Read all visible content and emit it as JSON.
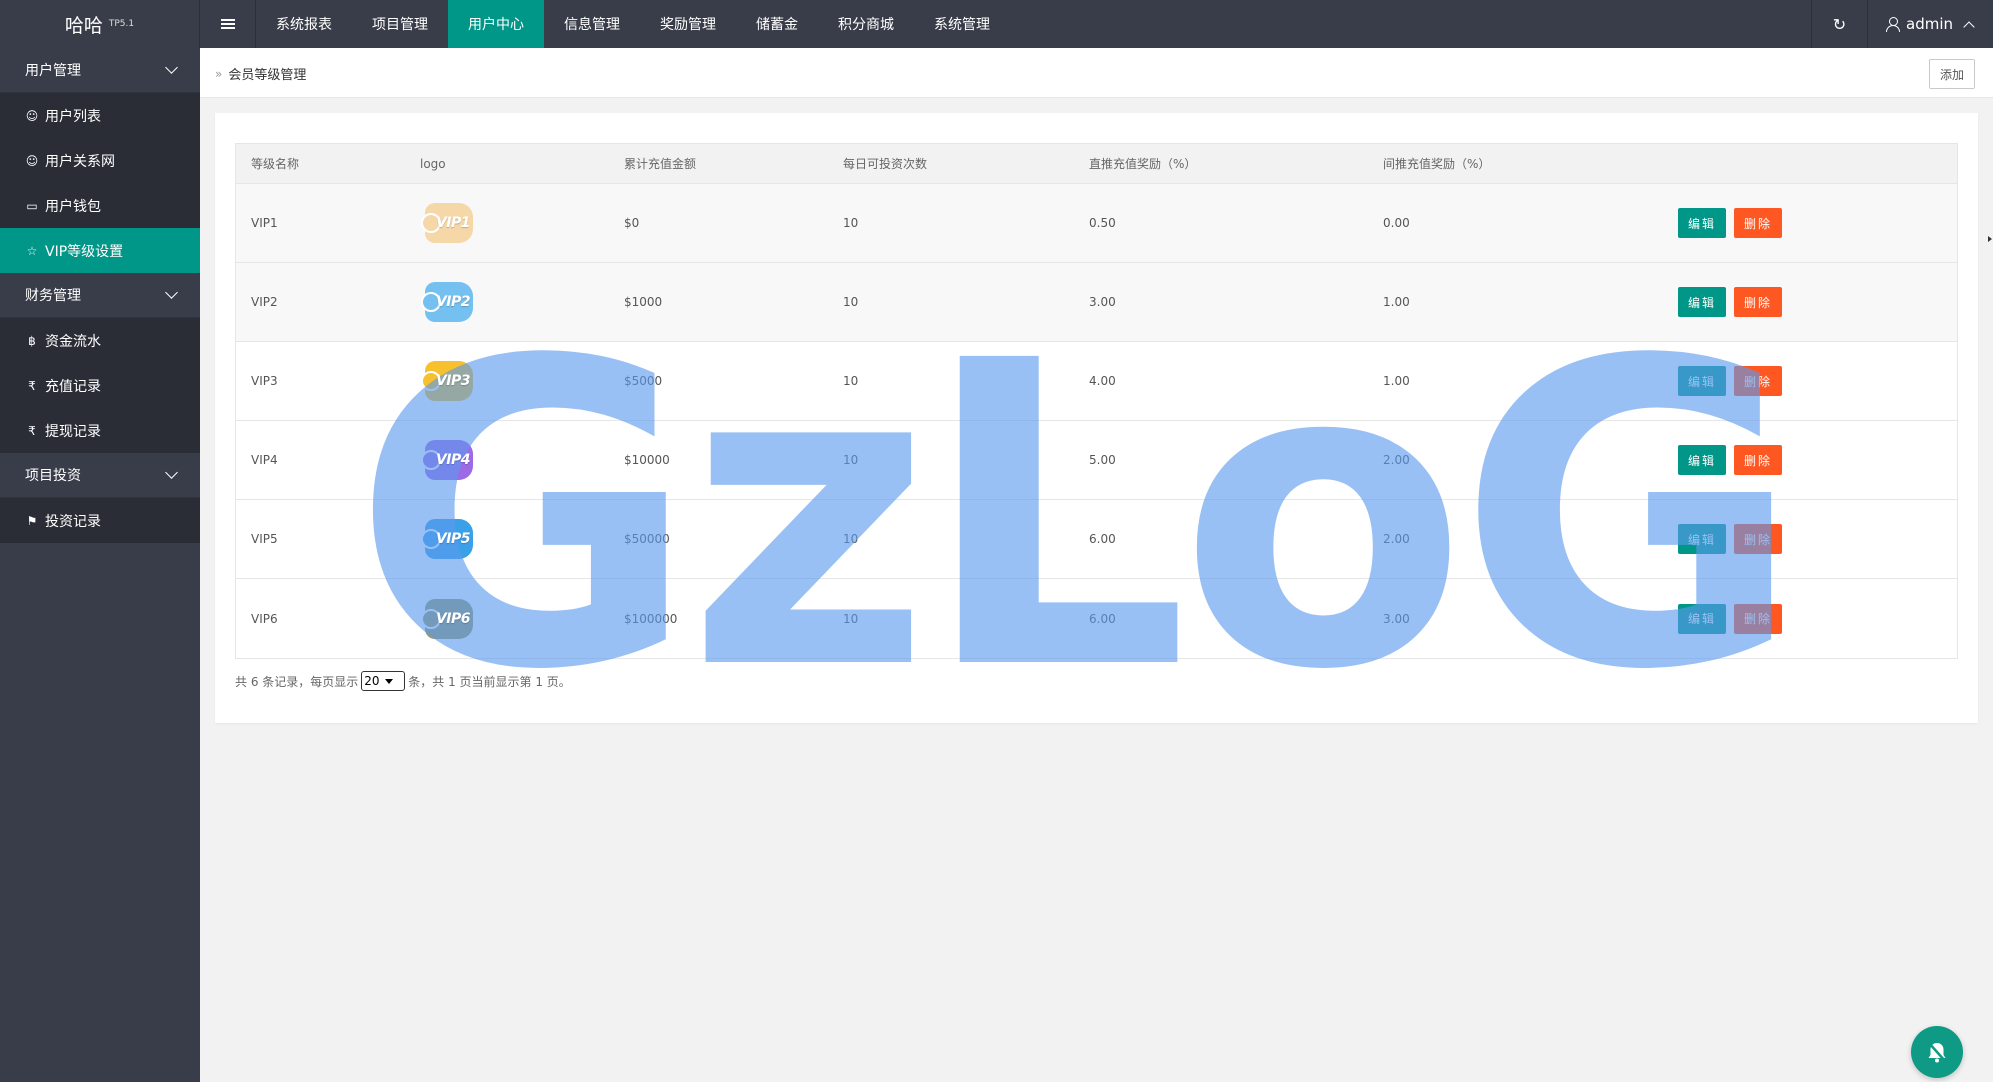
{
  "app": {
    "title": "哈哈",
    "version": "TP5.1"
  },
  "top_nav": {
    "items": [
      {
        "label": "系统报表"
      },
      {
        "label": "项目管理"
      },
      {
        "label": "用户中心"
      },
      {
        "label": "信息管理"
      },
      {
        "label": "奖励管理"
      },
      {
        "label": "储蓄金"
      },
      {
        "label": "积分商城"
      },
      {
        "label": "系统管理"
      }
    ],
    "active": "用户中心",
    "user": "admin"
  },
  "sidebar": {
    "groups": [
      {
        "label": "用户管理",
        "items": [
          {
            "label": "用户列表",
            "icon": "user-icon"
          },
          {
            "label": "用户关系网",
            "icon": "users-icon"
          },
          {
            "label": "用户钱包",
            "icon": "card-icon"
          },
          {
            "label": "VIP等级设置",
            "icon": "star-icon"
          }
        ]
      },
      {
        "label": "财务管理",
        "items": [
          {
            "label": "资金流水",
            "icon": "bitcoin-icon"
          },
          {
            "label": "充值记录",
            "icon": "rupee-icon"
          },
          {
            "label": "提现记录",
            "icon": "rupee-icon"
          }
        ]
      },
      {
        "label": "项目投资",
        "items": [
          {
            "label": "投资记录",
            "icon": "flag-icon"
          }
        ]
      }
    ],
    "active": "VIP等级设置"
  },
  "page": {
    "breadcrumb": "会员等级管理",
    "add_label": "添加"
  },
  "table": {
    "columns": [
      "等级名称",
      "logo",
      "累计充值金额",
      "每日可投资次数",
      "直推充值奖励（%）",
      "间推充值奖励（%）"
    ],
    "rows": [
      {
        "name": "VIP1",
        "logo": "VIP1",
        "logo_color": "#f5d7a8",
        "amount": "$0",
        "times": "10",
        "direct": "0.50",
        "indirect": "0.00"
      },
      {
        "name": "VIP2",
        "logo": "VIP2",
        "logo_color": "#74c0f0",
        "amount": "$1000",
        "times": "10",
        "direct": "3.00",
        "indirect": "1.00"
      },
      {
        "name": "VIP3",
        "logo": "VIP3",
        "logo_color": "#f6c02e",
        "amount": "$5000",
        "times": "10",
        "direct": "4.00",
        "indirect": "1.00"
      },
      {
        "name": "VIP4",
        "logo": "VIP4",
        "logo_color": "#9d6ae6",
        "amount": "$10000",
        "times": "10",
        "direct": "5.00",
        "indirect": "2.00"
      },
      {
        "name": "VIP5",
        "logo": "VIP5",
        "logo_color": "#3aa0e8",
        "amount": "$50000",
        "times": "10",
        "direct": "6.00",
        "indirect": "2.00"
      },
      {
        "name": "VIP6",
        "logo": "VIP6",
        "logo_color": "#9c9a6a",
        "amount": "$100000",
        "times": "10",
        "direct": "6.00",
        "indirect": "3.00"
      }
    ],
    "edit_label": "编辑",
    "delete_label": "删除"
  },
  "pager": {
    "prefix": "共 6 条记录，每页显示",
    "page_size": "20",
    "suffix": "条，共 1 页当前显示第 1 页。"
  },
  "watermark": "GzLoG",
  "colors": {
    "primary": "#009688",
    "danger": "#ff5722",
    "dark": "#393d49"
  }
}
